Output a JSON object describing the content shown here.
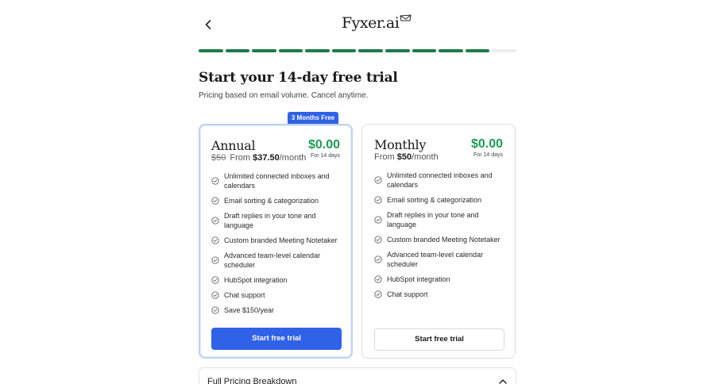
{
  "header": {
    "back_icon": "chevron-left-icon",
    "logo_text": "Fyxer.ai",
    "logo_icon": "envelope-icon"
  },
  "progress": {
    "completed_steps": 11,
    "total_steps": 12,
    "accent_color": "#1f7a4a"
  },
  "page": {
    "title": "Start your 14-day free trial",
    "subtitle": "Pricing based on email volume. Cancel anytime."
  },
  "plans": [
    {
      "id": "annual",
      "badge": "3 Months Free",
      "name": "Annual",
      "price": "$0.00",
      "price_note": "For 14 days",
      "original_price": "$50",
      "from_label": "From",
      "from_price": "$37.50",
      "per": "/month",
      "features": [
        "Unlimited connected inboxes and calendars",
        "Email sorting & categorization",
        "Draft replies in your tone and language",
        "Custom branded Meeting Notetaker",
        "Advanced team-level calendar scheduler",
        "HubSpot integration",
        "Chat support",
        "Save $150/year"
      ],
      "cta": "Start free trial"
    },
    {
      "id": "monthly",
      "name": "Monthly",
      "price": "$0.00",
      "price_note": "For 14 days",
      "from_label": "From",
      "from_price": "$50",
      "per": "/month",
      "features": [
        "Unlimited connected inboxes and calendars",
        "Email sorting & categorization",
        "Draft replies in your tone and language",
        "Custom branded Meeting Notetaker",
        "Advanced team-level calendar scheduler",
        "HubSpot integration",
        "Chat support"
      ],
      "cta": "Start free trial"
    }
  ],
  "breakdown": {
    "label": "Full Pricing Breakdown",
    "icon": "chevron-up-icon"
  },
  "colors": {
    "brand_blue": "#2f62e6",
    "price_green": "#1f9a55",
    "progress_green": "#1f7a4a"
  }
}
